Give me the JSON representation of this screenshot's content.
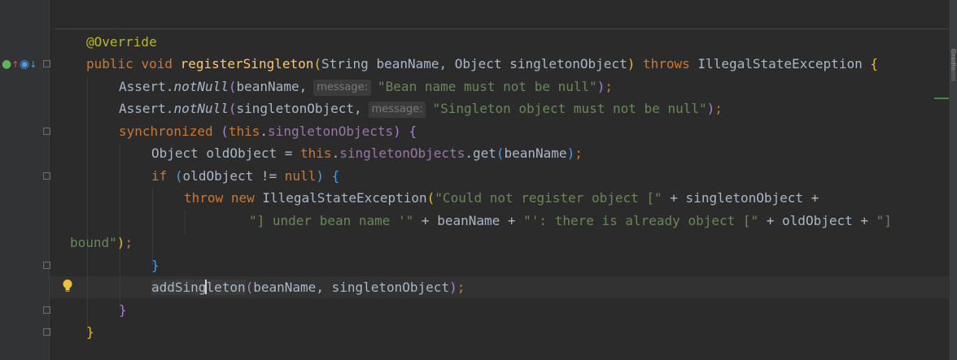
{
  "side_label": "Gradle",
  "hints": {
    "message": "message:"
  },
  "code": {
    "l1_annotation": "@Override",
    "l2_public": "public",
    "l2_void": "void",
    "l2_method": "registerSingleton",
    "l2_params": "String beanName, Object singletonObject",
    "l2_throws": "throws",
    "l2_exception": "IllegalStateException",
    "l3_class": "Assert.",
    "l3_method": "notNull",
    "l3_arg": "beanName,",
    "l3_str": "\"Bean name must not be null\"",
    "l4_class": "Assert.",
    "l4_method": "notNull",
    "l4_arg": "singletonObject,",
    "l4_str": "\"Singleton object must not be null\"",
    "l5_sync": "synchronized",
    "l5_this": "this",
    "l5_field": "singletonObjects",
    "l6_decl": "Object oldObject = ",
    "l6_this": "this",
    "l6_field": "singletonObjects",
    "l6_call": ".get",
    "l6_arg": "beanName",
    "l7_if": "if",
    "l7_cond": "oldObject != ",
    "l7_null": "null",
    "l8_throw": "throw",
    "l8_new": "new",
    "l8_exc": "IllegalStateException",
    "l8_str": "\"Could not register object [\"",
    "l8_rest": " + singletonObject +",
    "l9_str1": "\"] under bean name '\"",
    "l9_mid1": " + beanName + ",
    "l9_str2": "\"': there is already object [\"",
    "l9_mid2": " + oldObject + ",
    "l9_str3": "\"]",
    "l10_str": "bound\"",
    "l12_call_a": "addSing",
    "l12_call_b": "l",
    "l12_call_c": "eton",
    "l12_args": "beanName, singletonObject"
  }
}
